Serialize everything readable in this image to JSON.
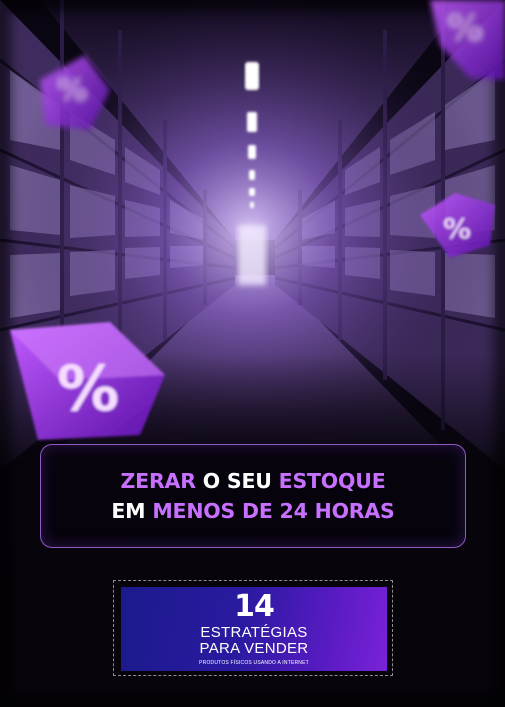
{
  "headline": {
    "line1": [
      {
        "text": "ZERAR",
        "accent": true
      },
      {
        "text": " O SEU ",
        "accent": false
      },
      {
        "text": "ESTOQUE",
        "accent": true
      }
    ],
    "line2": [
      {
        "text": "EM ",
        "accent": false
      },
      {
        "text": "MENOS DE 24 HORAS",
        "accent": true
      }
    ]
  },
  "badge": {
    "number": "14",
    "line1": "ESTRATÉGIAS",
    "line2": "PARA VENDER",
    "tagline": "PRODUTOS FÍSICOS USANDO A INTERNET"
  },
  "decor": {
    "percent_symbol": "%",
    "accent_color": "#c770ff",
    "badge_gradient": [
      "#1b1a8c",
      "#7a22d8"
    ]
  }
}
